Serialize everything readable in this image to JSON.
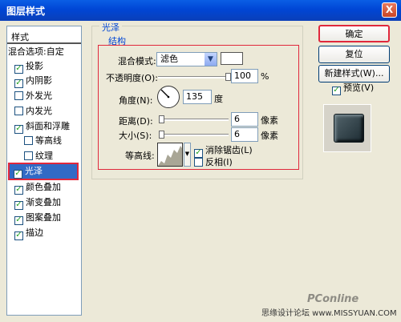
{
  "window": {
    "title": "图层样式",
    "close_label": "X"
  },
  "styles_panel": {
    "title": "样式",
    "items": [
      {
        "label": "混合选项:自定",
        "checkbox": false,
        "checked": false
      },
      {
        "label": "投影",
        "checkbox": true,
        "checked": true
      },
      {
        "label": "内阴影",
        "checkbox": true,
        "checked": true
      },
      {
        "label": "外发光",
        "checkbox": true,
        "checked": false
      },
      {
        "label": "内发光",
        "checkbox": true,
        "checked": false
      },
      {
        "label": "斜面和浮雕",
        "checkbox": true,
        "checked": true
      },
      {
        "label": "等高线",
        "checkbox": true,
        "checked": false
      },
      {
        "label": "纹理",
        "checkbox": true,
        "checked": false
      },
      {
        "label": "光泽",
        "checkbox": true,
        "checked": true,
        "selected": true
      },
      {
        "label": "颜色叠加",
        "checkbox": true,
        "checked": true
      },
      {
        "label": "渐变叠加",
        "checkbox": true,
        "checked": true
      },
      {
        "label": "图案叠加",
        "checkbox": true,
        "checked": true
      },
      {
        "label": "描边",
        "checkbox": true,
        "checked": true
      }
    ]
  },
  "satin": {
    "group_title": "光泽",
    "structure_title": "结构",
    "blend_mode_label": "混合模式:",
    "blend_mode_value": "滤色",
    "blend_color": "#ffffff",
    "opacity_label": "不透明度(O):",
    "opacity_value": "100",
    "opacity_unit": "%",
    "angle_label": "角度(N):",
    "angle_value": "135",
    "angle_unit": "度",
    "distance_label": "距离(D):",
    "distance_value": "6",
    "distance_unit": "像素",
    "size_label": "大小(S):",
    "size_value": "6",
    "size_unit": "像素",
    "contour_label": "等高线:",
    "antialias_label": "消除锯齿(L)",
    "antialias_checked": true,
    "invert_label": "反相(I)",
    "invert_checked": false
  },
  "buttons": {
    "ok": "确定",
    "reset": "复位",
    "new_style": "新建样式(W)...",
    "preview_label": "预览(V)",
    "preview_checked": true
  },
  "watermark": {
    "pconline": "PConline",
    "site": "思缘设计论坛 www.MISSYUAN.COM"
  }
}
